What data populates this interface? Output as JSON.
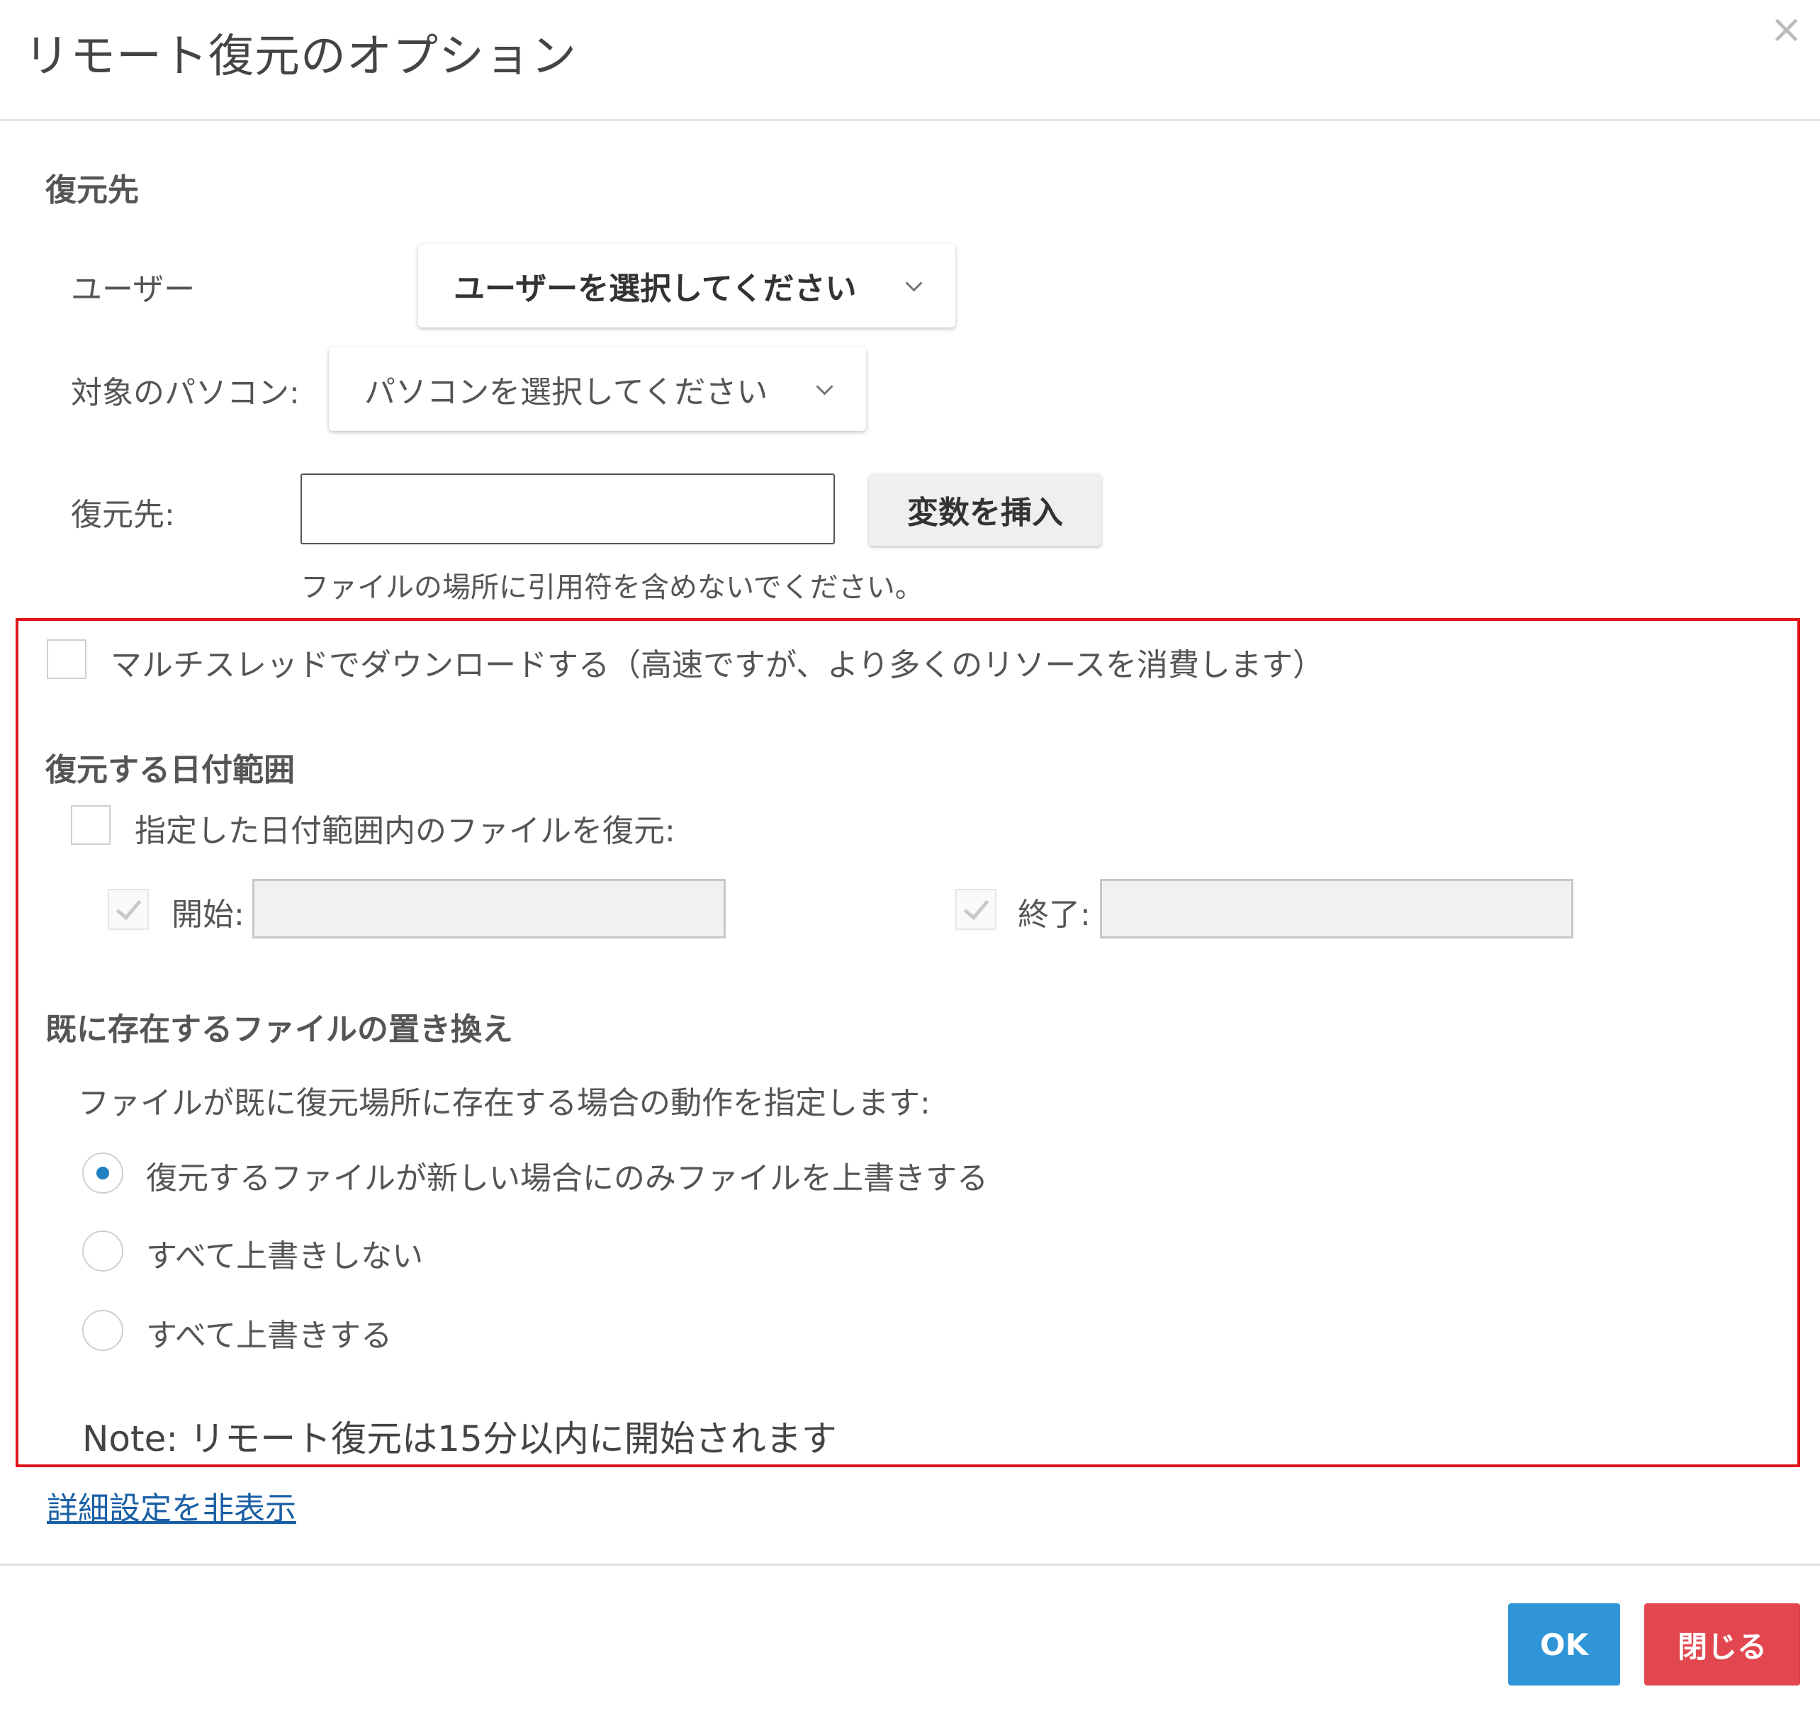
{
  "dialog": {
    "title": "リモート復元のオプション",
    "close_icon": "×"
  },
  "destination": {
    "section_title": "復元先",
    "user_label": "ユーザー",
    "user_select": "ユーザーを選択してください",
    "pc_label": "対象のパソコン:",
    "pc_select": "パソコンを選択してください",
    "path_label": "復元先:",
    "path_value": "",
    "insert_variable_button": "変数を挿入",
    "path_hint": "ファイルの場所に引用符を含めないでください。"
  },
  "advanced": {
    "multithread_label": "マルチスレッドでダウンロードする（高速ですが、より多くのリソースを消費します）",
    "multithread_checked": false,
    "date_range": {
      "section_title": "復元する日付範囲",
      "enable_label": "指定した日付範囲内のファイルを復元:",
      "enable_checked": false,
      "start_label": "開始:",
      "start_value": "",
      "end_label": "終了:",
      "end_value": ""
    },
    "overwrite": {
      "section_title": "既に存在するファイルの置き換え",
      "description": "ファイルが既に復元場所に存在する場合の動作を指定します:",
      "options": [
        {
          "label": "復元するファイルが新しい場合にのみファイルを上書きする",
          "selected": true
        },
        {
          "label": "すべて上書きしない",
          "selected": false
        },
        {
          "label": "すべて上書きする",
          "selected": false
        }
      ]
    },
    "note": "Note: リモート復元は15分以内に開始されます"
  },
  "hide_advanced_link": "詳細設定を非表示",
  "footer": {
    "ok_button": "OK",
    "close_button": "閉じる"
  },
  "colors": {
    "highlight_border": "#e0151b",
    "ok_button": "#2f95d6",
    "close_button": "#e2474f",
    "radio_selected": "#1f7fbf",
    "link": "#1a5fa5"
  }
}
